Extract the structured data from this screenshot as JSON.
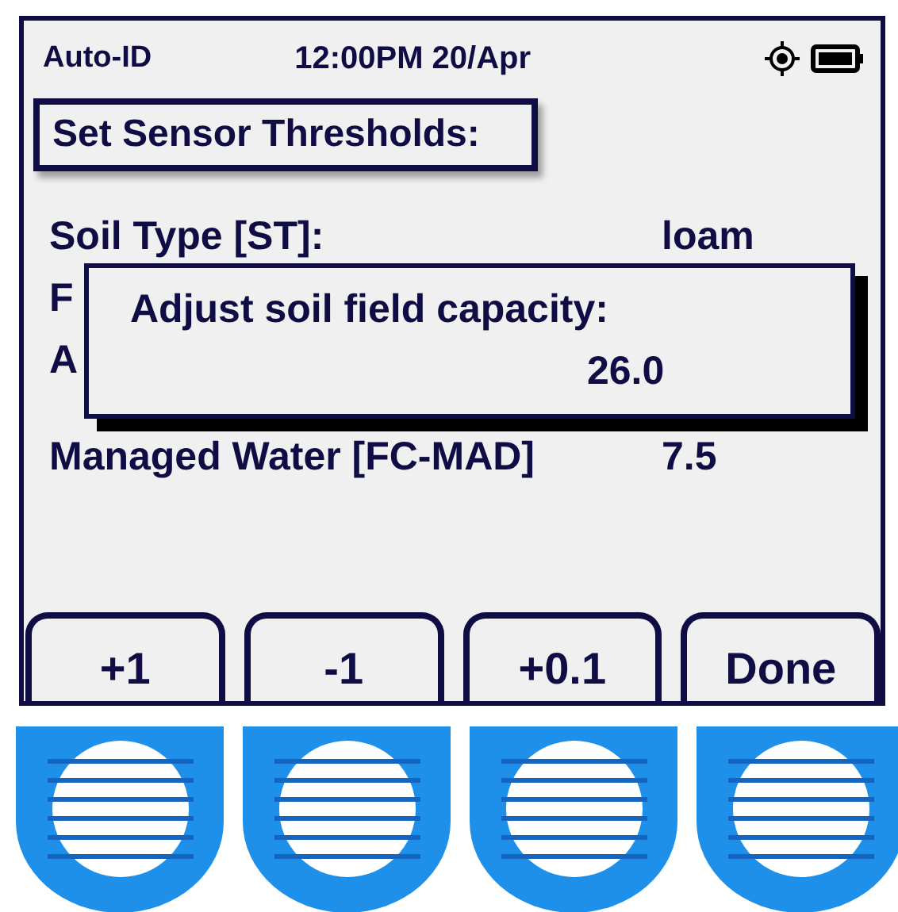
{
  "status_bar": {
    "app": "Auto-ID",
    "datetime": "12:00PM 20/Apr"
  },
  "title": "Set Sensor Thresholds:",
  "rows": [
    {
      "label": "Soil Type [ST]:",
      "value": "loam"
    },
    {
      "label": "F"
    },
    {
      "label": "A"
    },
    {
      "label": "Managed Water [FC-MAD]",
      "value": "7.5"
    }
  ],
  "dialog": {
    "prompt": "Adjust soil field capacity:",
    "value": "26.0"
  },
  "softkeys": [
    "+1",
    "-1",
    "+0.1",
    "Done"
  ]
}
